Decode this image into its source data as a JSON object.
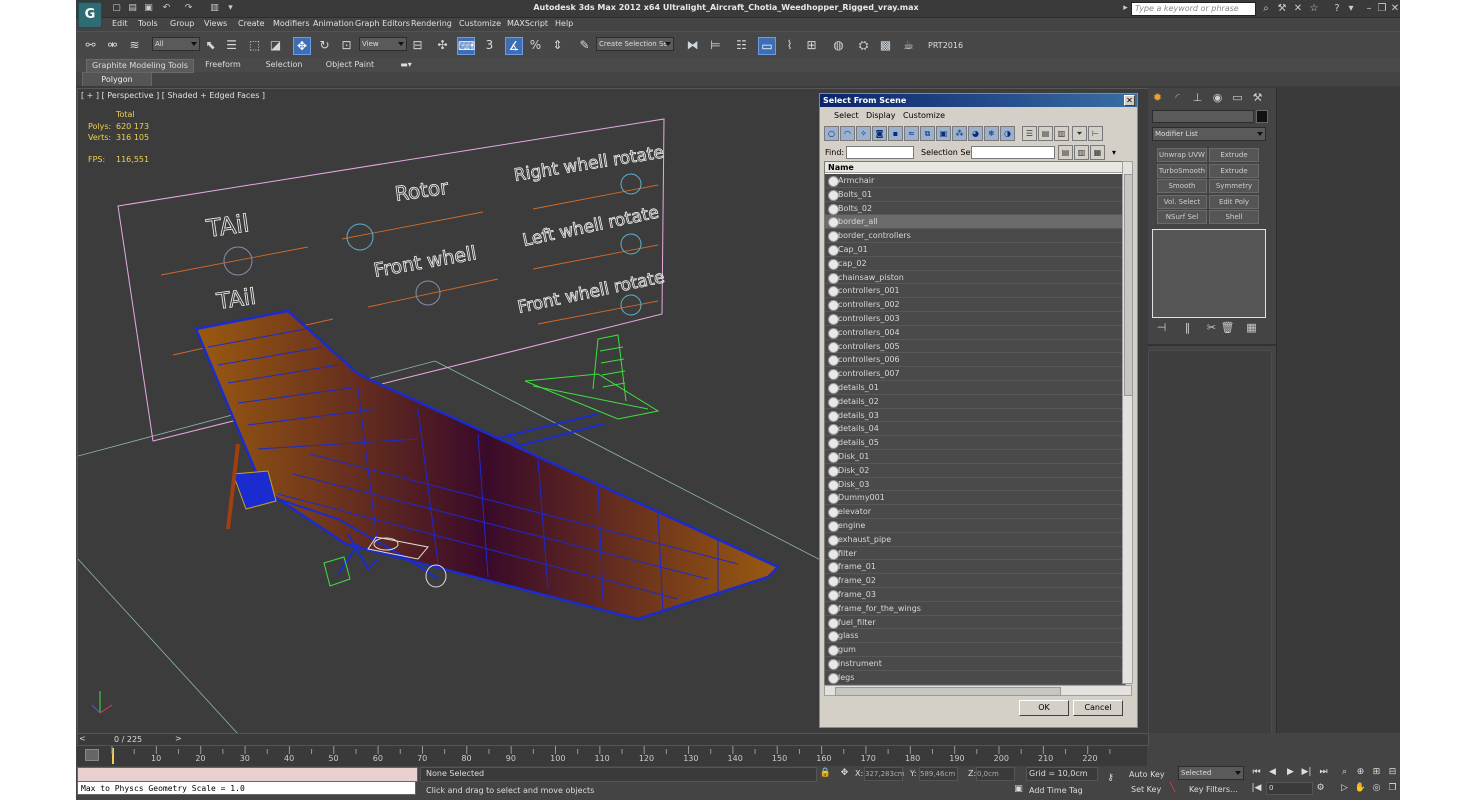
{
  "app": {
    "title": "Autodesk 3ds Max  2012 x64     Ultralight_Aircraft_Chotia_Weedhopper_Rigged_vray.max",
    "logo": "G",
    "search_placeholder": "Type a keyword or phrase"
  },
  "menu": [
    "Edit",
    "Tools",
    "Group",
    "Views",
    "Create",
    "Modifiers",
    "Animation",
    "Graph Editors",
    "Rendering",
    "Customize",
    "MAXScript",
    "Help"
  ],
  "toolbar": {
    "filter_value": "All",
    "refcoord_value": "View",
    "selection_set_value": "Create Selection Se",
    "snap_label": "3",
    "renderer_label": "PRT2016"
  },
  "ribbon": {
    "tabs": [
      "Graphite Modeling Tools",
      "Freeform",
      "Selection",
      "Object Paint"
    ],
    "sub_label": "Polygon Modeling"
  },
  "viewport": {
    "label": "[ + ] [ Perspective ] [ Shaded + Edged Faces ]",
    "stats": {
      "total_label": "Total",
      "polys_label": "Polys:",
      "polys_value": "620 173",
      "verts_label": "Verts:",
      "verts_value": "316 105",
      "fps_label": "FPS:",
      "fps_value": "116,551"
    },
    "board_labels": [
      "TAil",
      "TAil",
      "Rotor",
      "Front whell",
      "Right whell rotate",
      "Left whell rotate",
      "Front whell rotate"
    ]
  },
  "dialog": {
    "title": "Select From Scene",
    "menus": [
      "Select",
      "Display",
      "Customize"
    ],
    "find_label": "Find:",
    "selection_set_label": "Selection Set:",
    "column_name": "Name",
    "items": [
      "Armchair",
      "Bolts_01",
      "Bolts_02",
      "border_all",
      "border_controllers",
      "Cap_01",
      "cap_02",
      "chainsaw_piston",
      "controllers_001",
      "controllers_002",
      "controllers_003",
      "controllers_004",
      "controllers_005",
      "controllers_006",
      "controllers_007",
      "details_01",
      "details_02",
      "details_03",
      "details_04",
      "details_05",
      "Disk_01",
      "Disk_02",
      "Disk_03",
      "Dummy001",
      "elevator",
      "engine",
      "exhaust_pipe",
      "filter",
      "frame_01",
      "frame_02",
      "frame_03",
      "frame_for_the_wings",
      "fuel_filter",
      "glass",
      "gum",
      "instrument",
      "legs"
    ],
    "selected_item": "border_all",
    "ok_label": "OK",
    "cancel_label": "Cancel"
  },
  "command_panel": {
    "modifier_list_label": "Modifier List",
    "buttons": [
      "Unwrap UVW",
      "Extrude",
      "TurboSmooth",
      "Extrude",
      "Smooth",
      "Symmetry",
      "Vol. Select",
      "Edit Poly",
      "NSurf Sel",
      "Shell"
    ]
  },
  "timeline": {
    "frame_label": "0 / 225",
    "ticks": [
      "10",
      "20",
      "30",
      "40",
      "50",
      "60",
      "70",
      "80",
      "90",
      "100",
      "110",
      "120",
      "130",
      "140",
      "150",
      "160",
      "170",
      "180",
      "190",
      "200",
      "210",
      "220"
    ]
  },
  "status": {
    "maxscript_text": "Max to Physcs Geometry Scale = 1.0",
    "selection_text": "None Selected",
    "prompt_text": "Click and drag to select and move objects",
    "x_label": "X:",
    "x_value": "327,283cm",
    "y_label": "Y:",
    "y_value": "589,46cm",
    "z_label": "Z:",
    "z_value": "0,0cm",
    "grid_text": "Grid = 10,0cm",
    "add_time_tag": "Add Time Tag",
    "auto_key": "Auto Key",
    "set_key": "Set Key",
    "selected_value": "Selected",
    "key_filters": "Key Filters...",
    "frame_value": "0"
  },
  "colors": {
    "viewport_bg": "#3c3c3c",
    "wire_blue": "#1a2bd0",
    "wire_green": "#3fe03f",
    "board_pink": "#e8a8e0",
    "wing_dark": "#3a0a2a",
    "wing_orange": "#9a5a10",
    "stats_yellow": "#f0d050"
  }
}
